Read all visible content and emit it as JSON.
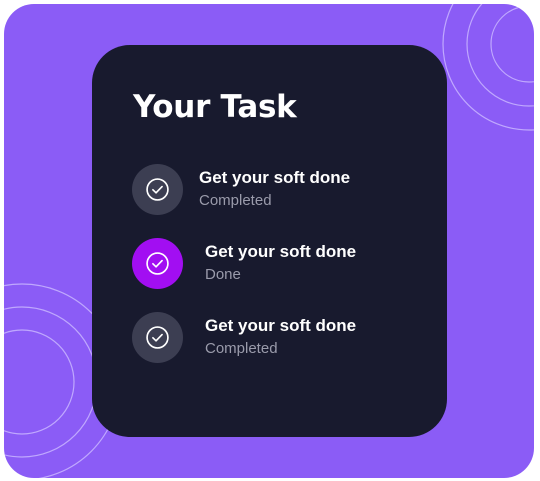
{
  "card": {
    "title": "Your Task"
  },
  "tasks": [
    {
      "title": "Get your soft done",
      "status": "Completed",
      "icon": "check-circle-icon",
      "active": false
    },
    {
      "title": "Get your soft done",
      "status": "Done",
      "icon": "check-circle-icon",
      "active": true
    },
    {
      "title": "Get your soft done",
      "status": "Completed",
      "icon": "check-circle-icon",
      "active": false
    }
  ],
  "colors": {
    "background": "#8b5cf6",
    "card": "#181a2e",
    "check_default": "#3c3e52",
    "check_active": "#a20ef2",
    "status_text": "#9a9bab"
  }
}
